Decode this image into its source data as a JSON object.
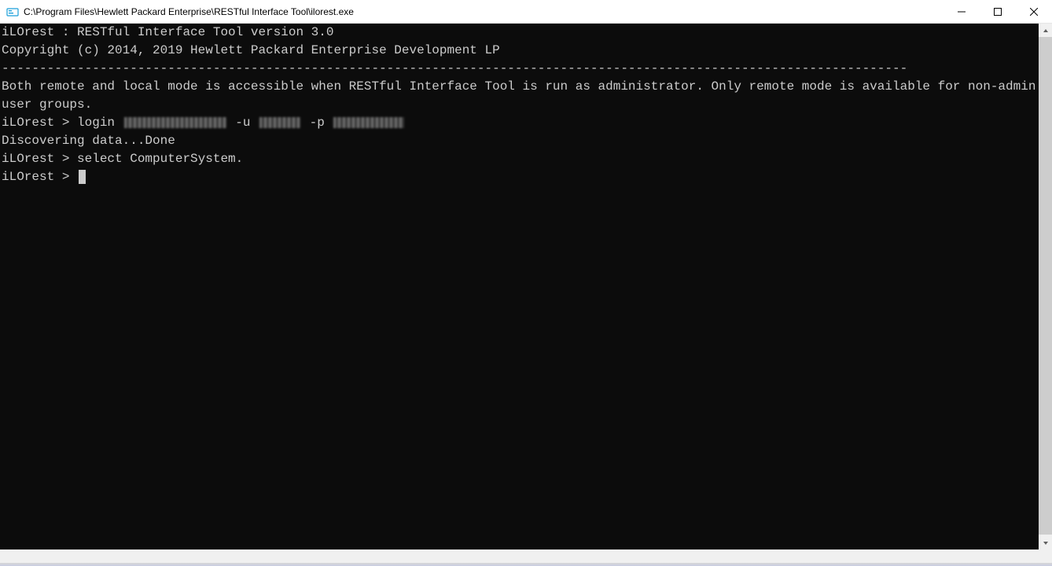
{
  "window": {
    "title": "C:\\Program Files\\Hewlett Packard Enterprise\\RESTful Interface Tool\\ilorest.exe"
  },
  "terminal": {
    "line1": "iLOrest : RESTful Interface Tool version 3.0",
    "line2": "Copyright (c) 2014, 2019 Hewlett Packard Enterprise Development LP",
    "divider": "------------------------------------------------------------------------------------------------------------------------",
    "line3": "Both remote and local mode is accessible when RESTful Interface Tool is run as administrator. Only remote mode is available for non-admin user groups.",
    "login_prefix": "iLOrest > login ",
    "login_uflag": " -u ",
    "login_pflag": " -p ",
    "line5": "Discovering data...Done",
    "line6": "iLOrest > select ComputerSystem.",
    "prompt": "iLOrest > "
  }
}
